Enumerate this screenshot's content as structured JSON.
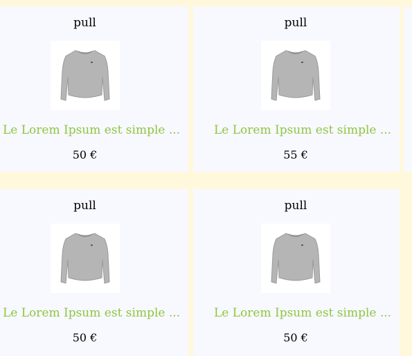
{
  "products": [
    {
      "title": "pull",
      "description": "Le Lorem Ipsum est simple ...",
      "price": "50 €",
      "image_icon": "sweater-icon"
    },
    {
      "title": "pull",
      "description": "Le Lorem Ipsum est simple ...",
      "price": "55 €",
      "image_icon": "sweater-icon"
    },
    {
      "title": "pull",
      "description": "Le Lorem Ipsum est simple ...",
      "price": "50 €",
      "image_icon": "sweater-icon"
    },
    {
      "title": "pull",
      "description": "Le Lorem Ipsum est simple ...",
      "price": "50 €",
      "image_icon": "sweater-icon"
    }
  ],
  "colors": {
    "page_background": "#fff8dc",
    "card_background": "#f8f8ff",
    "description_text": "#8dc63f",
    "sweater": "#b5b5b5"
  }
}
